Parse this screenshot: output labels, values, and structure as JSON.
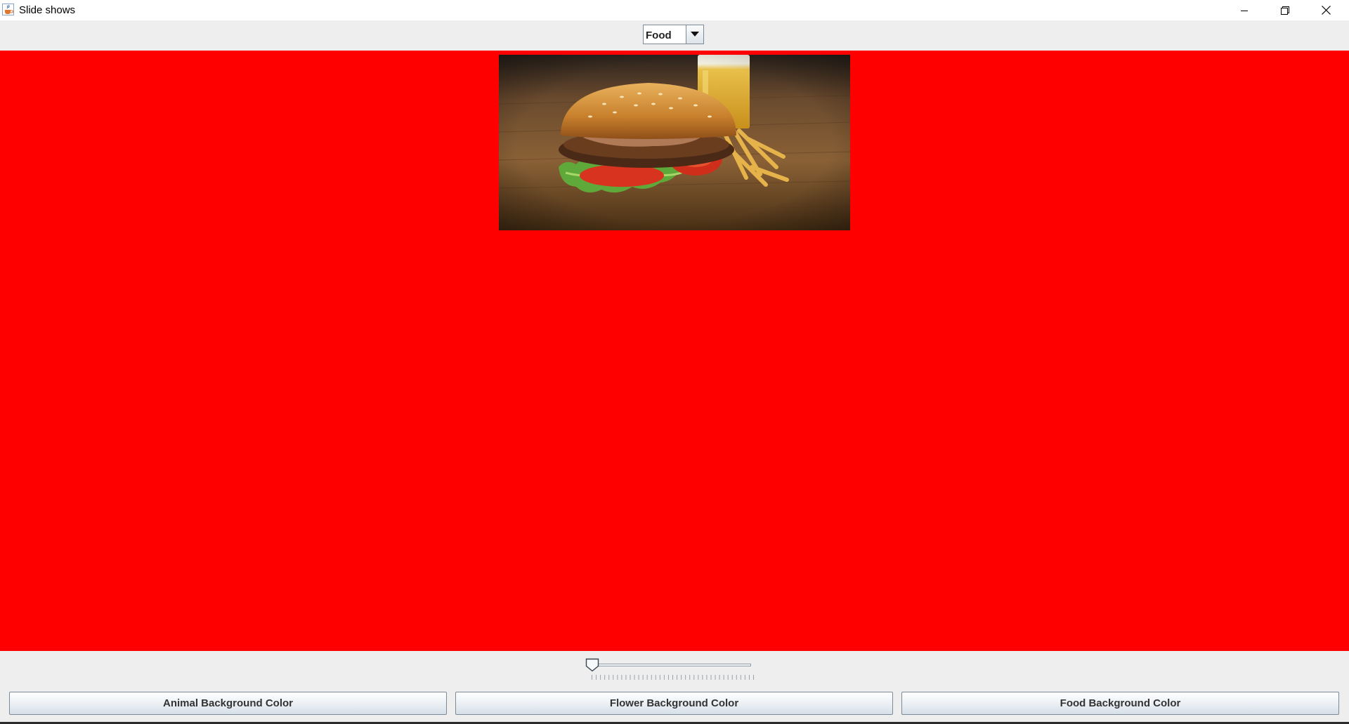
{
  "window": {
    "title": "Slide shows",
    "icon": "java-cup-icon"
  },
  "title_buttons": {
    "minimize": "minimize-icon",
    "maximize": "restore-icon",
    "close": "close-icon"
  },
  "category_select": {
    "selected": "Food",
    "icon": "chevron-down-icon"
  },
  "slide": {
    "background_color": "#ff0000",
    "image": "burger-with-fries-and-beer-photo"
  },
  "slider": {
    "value_fraction": 0.0,
    "tick_count": 39
  },
  "buttons": {
    "animal": "Animal Background Color",
    "flower": "Flower Background Color",
    "food": "Food Background Color"
  }
}
